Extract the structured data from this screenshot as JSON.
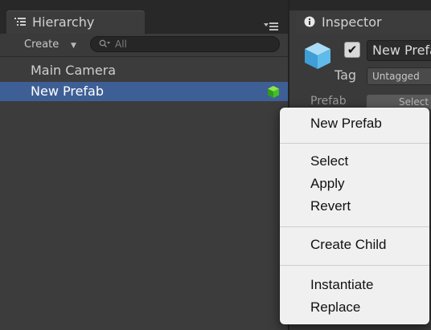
{
  "hierarchy": {
    "tab_label": "Hierarchy",
    "create_label": "Create",
    "search_placeholder": "All",
    "items": [
      {
        "label": "Main Camera"
      },
      {
        "label": "New Prefab"
      }
    ],
    "selected_color": "#3e5f96"
  },
  "inspector": {
    "tab_label": "Inspector",
    "object_name": "New Prefab",
    "active_checked": true,
    "tag_label": "Tag",
    "tag_value": "Untagged",
    "prefab_label": "Prefab",
    "prefab_button_label": "Select"
  },
  "context_menu": {
    "items": [
      {
        "label": "New Prefab"
      },
      {
        "label": "Select"
      },
      {
        "label": "Apply"
      },
      {
        "label": "Revert"
      },
      {
        "label": "Create Child"
      },
      {
        "label": "Instantiate"
      },
      {
        "label": "Replace"
      }
    ]
  },
  "icons": {
    "hierarchy_tab": "list-icon",
    "panel_menu": "panel-menu-icon",
    "search": "search-icon",
    "prefab": "green-cube-icon",
    "inspector_tab": "info-icon",
    "game_object": "blue-cube-icon",
    "active_toggle": "checkbox-icon"
  }
}
